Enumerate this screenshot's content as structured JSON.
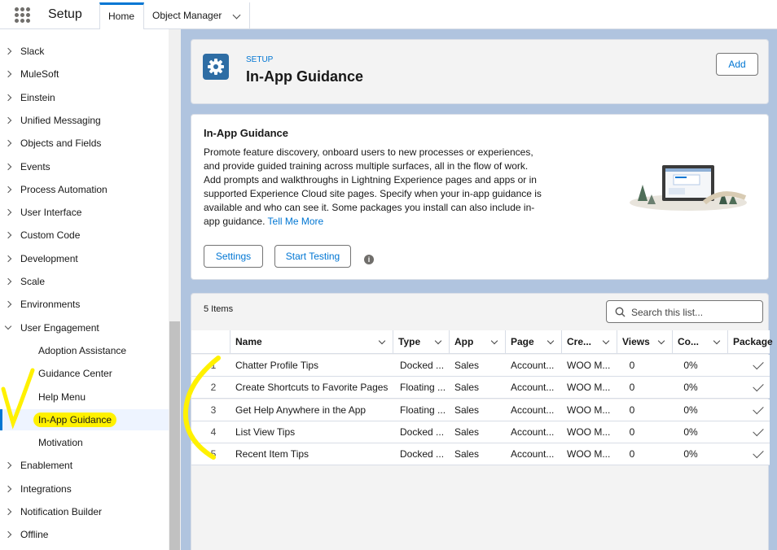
{
  "header": {
    "app_title": "Setup",
    "tabs": [
      {
        "label": "Home"
      },
      {
        "label": "Object Manager"
      }
    ]
  },
  "sidebar": {
    "items": [
      {
        "label": "Slack"
      },
      {
        "label": "MuleSoft"
      },
      {
        "label": "Einstein"
      },
      {
        "label": "Unified Messaging"
      },
      {
        "label": "Objects and Fields"
      },
      {
        "label": "Events"
      },
      {
        "label": "Process Automation"
      },
      {
        "label": "User Interface"
      },
      {
        "label": "Custom Code"
      },
      {
        "label": "Development"
      },
      {
        "label": "Scale"
      },
      {
        "label": "Environments"
      },
      {
        "label": "User Engagement"
      }
    ],
    "sub_items": [
      {
        "label": "Adoption Assistance"
      },
      {
        "label": "Guidance Center"
      },
      {
        "label": "Help Menu"
      },
      {
        "label": "In-App Guidance"
      },
      {
        "label": "Motivation"
      }
    ],
    "items_after": [
      {
        "label": "Enablement"
      },
      {
        "label": "Integrations"
      },
      {
        "label": "Notification Builder"
      },
      {
        "label": "Offline"
      }
    ]
  },
  "page_header": {
    "eyebrow": "SETUP",
    "title": "In-App Guidance",
    "add_label": "Add"
  },
  "info_card": {
    "title": "In-App Guidance",
    "description": "Promote feature discovery, onboard users to new processes or experiences, and provide guided training across multiple surfaces, all in the flow of work. Add prompts and walkthroughs in Lightning Experience pages and apps or in supported Experience Cloud site pages. Specify when your in-app guidance is available and who can see it. Some packages you install can also include in-app guidance.",
    "link": "Tell Me More",
    "settings_label": "Settings",
    "start_testing_label": "Start Testing",
    "info_glyph": "i"
  },
  "list": {
    "count": "5 Items",
    "search_placeholder": "Search this list...",
    "columns": [
      "Name",
      "Type",
      "App",
      "Page",
      "Cre...",
      "Views",
      "Co...",
      "Package"
    ],
    "rows": [
      {
        "num": "1",
        "name": "Chatter Profile Tips",
        "type": "Docked ...",
        "app": "Sales",
        "page": "Account...",
        "creator": "WOO M...",
        "views": "0",
        "completion": "0%",
        "package": true
      },
      {
        "num": "2",
        "name": "Create Shortcuts to Favorite Pages",
        "type": "Floating ...",
        "app": "Sales",
        "page": "Account...",
        "creator": "WOO M...",
        "views": "0",
        "completion": "0%",
        "package": true
      },
      {
        "num": "3",
        "name": "Get Help Anywhere in the App",
        "type": "Floating ...",
        "app": "Sales",
        "page": "Account...",
        "creator": "WOO M...",
        "views": "0",
        "completion": "0%",
        "package": true
      },
      {
        "num": "4",
        "name": "List View Tips",
        "type": "Docked ...",
        "app": "Sales",
        "page": "Account...",
        "creator": "WOO M...",
        "views": "0",
        "completion": "0%",
        "package": true
      },
      {
        "num": "5",
        "name": "Recent Item Tips",
        "type": "Docked ...",
        "app": "Sales",
        "page": "Account...",
        "creator": "WOO M...",
        "views": "0",
        "completion": "0%",
        "package": true
      }
    ]
  },
  "colors": {
    "brand": "#0176d3",
    "page_bg": "#b0c4df",
    "highlight": "#fff100"
  }
}
